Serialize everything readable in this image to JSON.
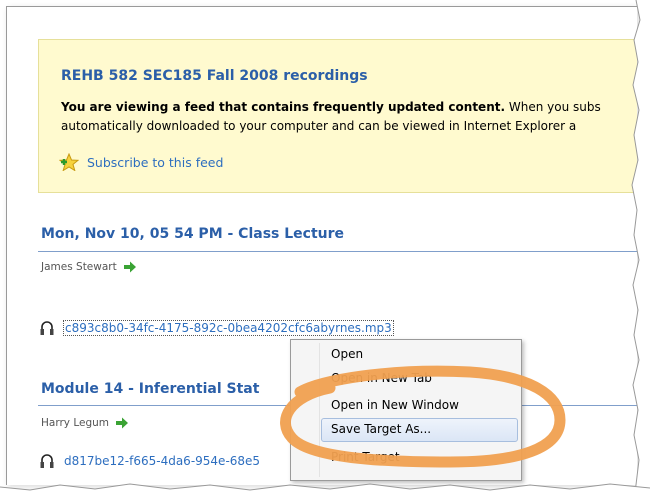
{
  "feed": {
    "title": "REHB 582 SEC185 Fall 2008 recordings",
    "notice_bold": "You are viewing a feed that contains frequently updated content.",
    "notice_rest": " When you subs",
    "notice_line2": "automatically downloaded to your computer and can be viewed in Internet Explorer a",
    "subscribe_label": "Subscribe to this feed"
  },
  "entries": [
    {
      "title": "Mon, Nov 10, 05 54 PM - Class Lecture",
      "author": "James Stewart",
      "enclosure": "c893c8b0-34fc-4175-892c-0bea4202cfc6abyrnes.mp3"
    },
    {
      "title": "Module 14 - Inferential Stat",
      "author": "Harry Legum",
      "enclosure": "d817be12-f665-4da6-954e-68e5"
    }
  ],
  "context_menu": {
    "items": [
      "Open",
      "Open in New Tab",
      "Open in New Window",
      "Save Target As...",
      "Print Target"
    ],
    "highlighted": "Save Target As...",
    "visible_fragment_tab": "New Tab"
  },
  "colors": {
    "link": "#2d6ebf",
    "title": "#2b5fa8",
    "banner_bg": "#fffacf",
    "annotation": "#f0a050"
  },
  "icons": [
    "star-feed-icon",
    "green-arrow-icon",
    "audio-headphones-icon"
  ]
}
